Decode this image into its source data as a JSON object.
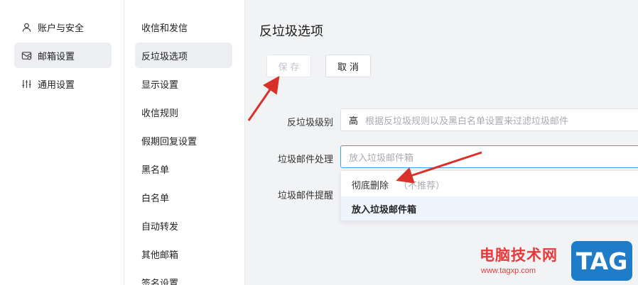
{
  "sidebar": {
    "items": [
      {
        "label": "账户与安全",
        "icon": "user-icon"
      },
      {
        "label": "邮箱设置",
        "icon": "mailbox-icon"
      },
      {
        "label": "通用设置",
        "icon": "sliders-icon"
      }
    ]
  },
  "subnav": {
    "items": [
      "收信和发信",
      "反垃圾选项",
      "显示设置",
      "收信规则",
      "假期回复设置",
      "黑名单",
      "白名单",
      "自动转发",
      "其他邮箱",
      "签名设置"
    ]
  },
  "main": {
    "title": "反垃圾选项",
    "save_label": "保存",
    "cancel_label": "取消",
    "level_label": "反垃圾级别",
    "level_value": "高",
    "level_desc": "根据反垃圾规则以及黑白名单设置来过滤垃圾邮件",
    "handle_label": "垃圾邮件处理",
    "handle_placeholder": "放入垃圾邮件箱",
    "remind_label": "垃圾邮件提醒",
    "dropdown": [
      {
        "label": "彻底删除",
        "note": "（不推荐）"
      },
      {
        "label": "放入垃圾邮件箱",
        "note": ""
      }
    ]
  },
  "watermark": {
    "site": "电脑技术网",
    "url": "www.tagxp.com",
    "tag": "TAG"
  },
  "colors": {
    "accent": "#409eff",
    "arrow": "#d9312a",
    "watermark_red": "#e63a3a",
    "tag_blue": "#1f7cc8"
  }
}
